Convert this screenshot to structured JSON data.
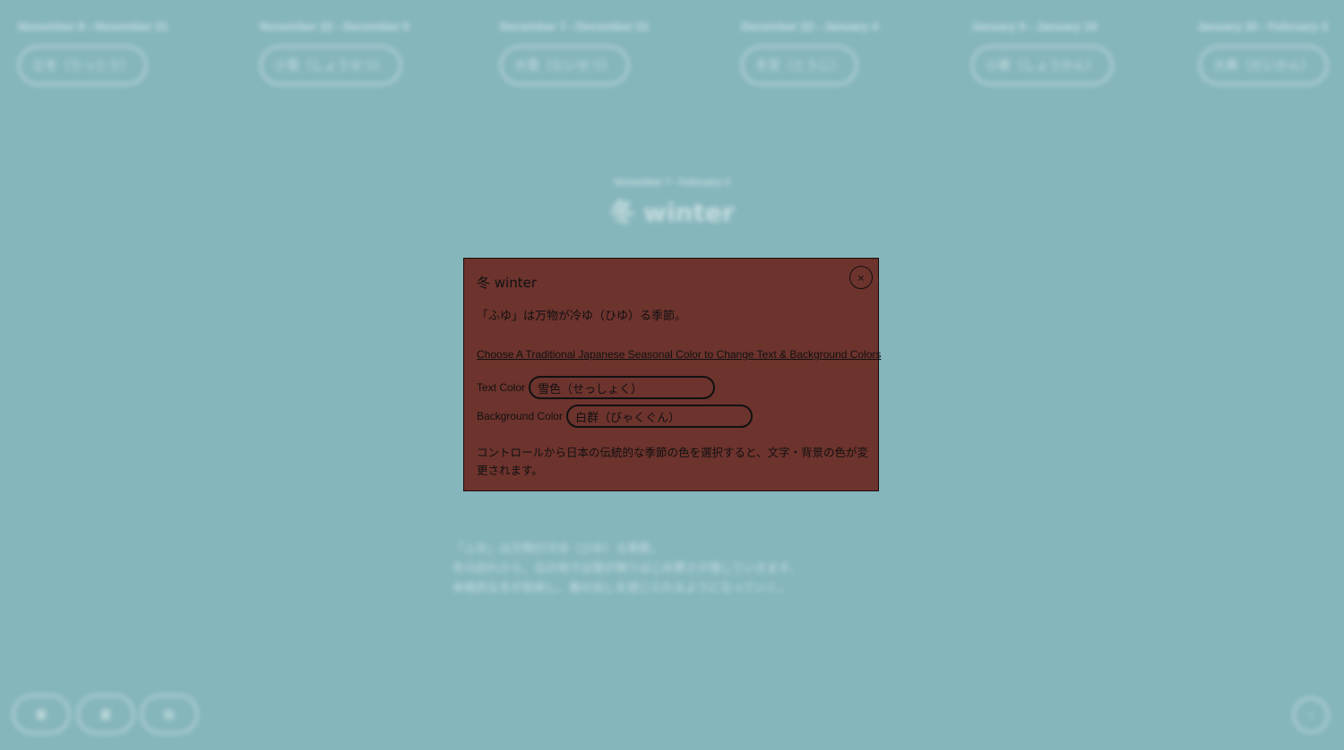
{
  "terms": [
    {
      "range": "November 8 - November 21",
      "name": "立冬（りっとう）"
    },
    {
      "range": "November 22 - December 6",
      "name": "小雪（しょうせつ）"
    },
    {
      "range": "December 7 - December 21",
      "name": "大雪（たいせつ）"
    },
    {
      "range": "December 22 - January 4",
      "name": "冬至（とうじ）"
    },
    {
      "range": "January 5 - January 19",
      "name": "小寒（しょうかん）"
    },
    {
      "range": "January 20 - February 3",
      "name": "大寒（だいかん）"
    }
  ],
  "season": {
    "range": "November 7 - February 3",
    "title": "冬 winter",
    "description_lines": [
      "「ふゆ」は万物が冷ゆ（ひゆ）る季節。",
      "冬の訪れから、北の地では雪が降りはじめ寒さが増していきます。",
      "本格的な冬が到来し、春の兆しを感じられるようになっていく。"
    ]
  },
  "nav": {
    "buttons": [
      "春",
      "夏",
      "秋"
    ],
    "next_label": "›"
  },
  "modal": {
    "title": "冬 winter",
    "close_label": "×",
    "subtitle": "「ふゆ」は万物が冷ゆ（ひゆ）る季節。",
    "link_text": "Choose A Traditional Japanese Seasonal Color to Change Text & Background Colors",
    "text_color_label": "Text Color",
    "text_color_value": "雪色（せっしょく）",
    "bg_color_label": "Background Color",
    "bg_color_value": "白群（びゃくぐん）",
    "note": "コントロールから日本の伝統的な季節の色を選択すると、文字・背景の色が変更されます。"
  },
  "colors": {
    "page_background": "#85b6bc",
    "modal_background": "#6d332d",
    "modal_text": "#111111"
  }
}
